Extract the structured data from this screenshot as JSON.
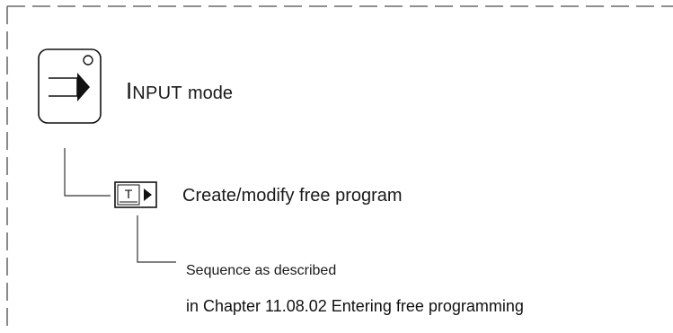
{
  "mode": {
    "title_initial": "I",
    "title_rest": "NPUT",
    "title_suffix": "mode",
    "key_icon": "input-key-icon"
  },
  "step": {
    "softkey_icon": "text-softkey-icon",
    "softkey_letter": "T",
    "label": "Create/modify free program"
  },
  "note": {
    "line1": "Sequence as described",
    "line2": "in Chapter 11.08.02 Entering free programming"
  },
  "colors": {
    "ink": "#1a1a1a",
    "frame": "#4a4a4a"
  }
}
